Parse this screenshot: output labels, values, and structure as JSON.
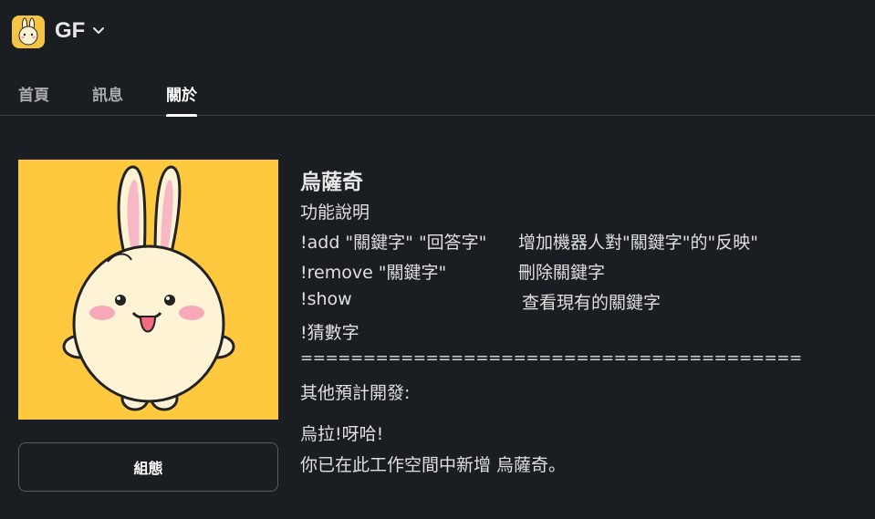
{
  "workspace": {
    "name": "GF"
  },
  "tabs": [
    {
      "label": "首頁",
      "active": false
    },
    {
      "label": "訊息",
      "active": false
    },
    {
      "label": "關於",
      "active": true
    }
  ],
  "profile": {
    "name": "烏薩奇",
    "config_button": "組態"
  },
  "description": {
    "heading": "功能說明",
    "commands": [
      {
        "command": "!add \"關鍵字\" \"回答字\"",
        "effect": "增加機器人對\"關鍵字\"的\"反映\""
      },
      {
        "command": "!remove \"關鍵字\"",
        "effect": "刪除關鍵字"
      },
      {
        "command": "!show",
        "effect": "查看現有的關鍵字"
      },
      {
        "command": "!猜數字",
        "effect": ""
      }
    ],
    "divider": "========================================",
    "future": "其他預計開發:",
    "greeting": "烏拉!呀哈!",
    "added_note": "你已在此工作空間中新增 烏薩奇。"
  },
  "colors": {
    "background": "#1a1d21",
    "avatar_bg": "#fec93f",
    "text": "#e0e0e0"
  }
}
